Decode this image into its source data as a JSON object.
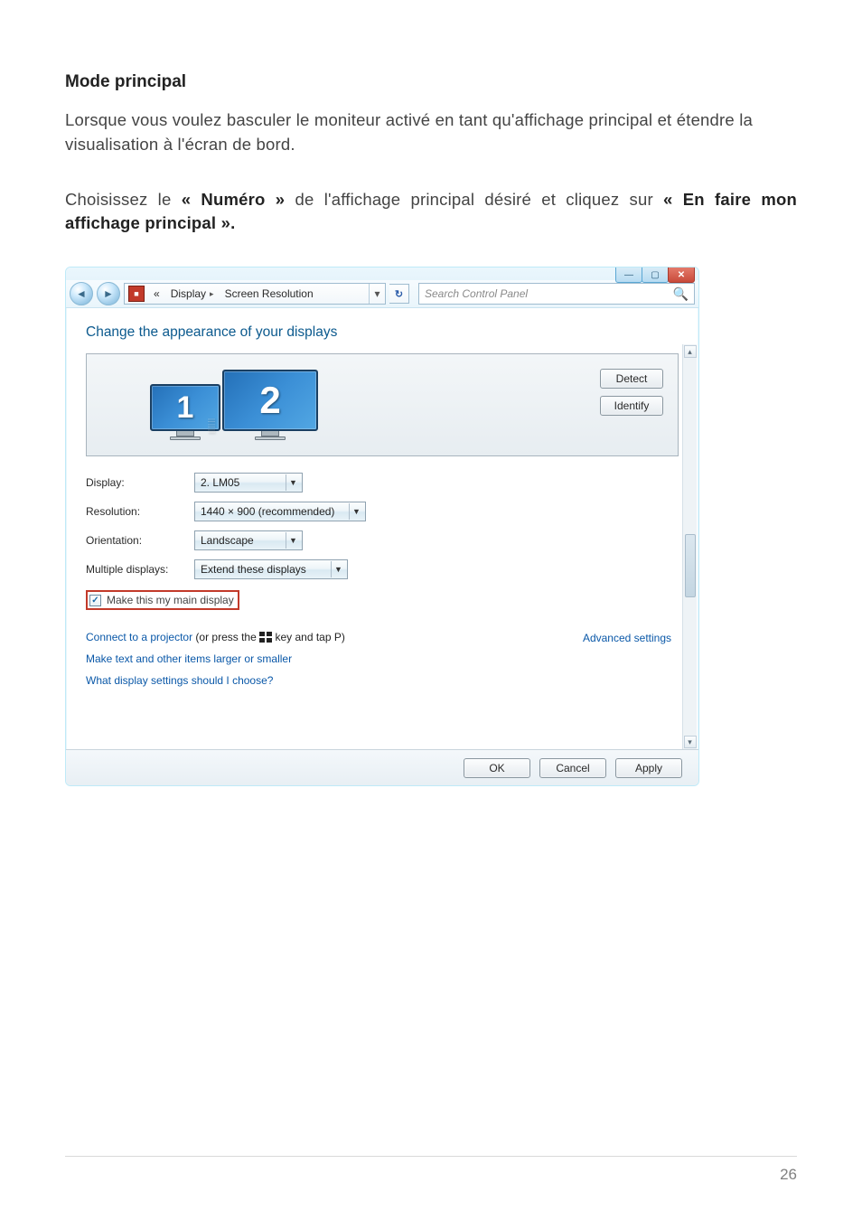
{
  "doc": {
    "heading": "Mode principal",
    "para1": "Lorsque vous voulez basculer le moniteur activé en tant qu'affichage principal et étendre la visualisation à l'écran de bord.",
    "para2_pre": "Choisissez le ",
    "para2_b1": "« Numéro »",
    "para2_mid": " de l'affichage principal désiré et cliquez sur ",
    "para2_b2": "« En faire mon affichage principal ».",
    "page_number": "26"
  },
  "win": {
    "btn_min": "—",
    "btn_max": "▢",
    "btn_close": "✕",
    "nav_back": "◄",
    "nav_fwd": "►",
    "path_chevrons": "«",
    "path_seg1": "Display",
    "path_sep": "▸",
    "path_seg2": "Screen Resolution",
    "path_dd": "▾",
    "refresh": "↻",
    "search_placeholder": "Search Control Panel",
    "title": "Change the appearance of your displays",
    "mon1": "1",
    "mon2": "2",
    "btn_detect": "Detect",
    "btn_identify": "Identify",
    "labels": {
      "display": "Display:",
      "resolution": "Resolution:",
      "orientation": "Orientation:",
      "multiple": "Multiple displays:"
    },
    "values": {
      "display": "2. LM05",
      "resolution": "1440 × 900 (recommended)",
      "orientation": "Landscape",
      "multiple": "Extend these displays"
    },
    "checkbox_mark": "✓",
    "checkbox_label": "Make this my main display",
    "adv_link": "Advanced settings",
    "link_projector_a": "Connect to a projector",
    "link_projector_b": " (or press the ",
    "link_projector_c": " key and tap P)",
    "link_textsize": "Make text and other items larger or smaller",
    "link_which": "What display settings should I choose?",
    "btn_ok": "OK",
    "btn_cancel": "Cancel",
    "btn_apply": "Apply",
    "sb_up": "▴",
    "sb_down": "▾"
  }
}
